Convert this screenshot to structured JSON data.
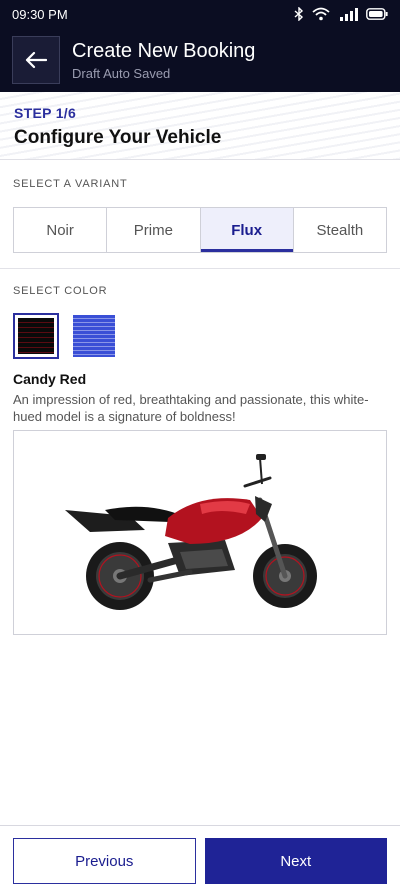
{
  "status": {
    "time": "09:30 PM",
    "icons": [
      "bluetooth-icon",
      "wifi-icon",
      "signal-5g-icon",
      "battery-icon"
    ]
  },
  "header": {
    "title": "Create New Booking",
    "subtitle": "Draft Auto Saved",
    "back_icon": "arrow-left-icon"
  },
  "step": {
    "label": "STEP 1/6",
    "title": "Configure Your Vehicle"
  },
  "variant": {
    "section_label": "SELECT A VARIANT",
    "options": [
      "Noir",
      "Prime",
      "Flux",
      "Stealth"
    ],
    "selected": "Flux"
  },
  "color": {
    "section_label": "SELECT COLOR",
    "swatches": [
      {
        "name": "red-swatch",
        "hex": "#5a0b12"
      },
      {
        "name": "blue-swatch",
        "hex": "#3a4fd6"
      }
    ],
    "selected_name": "Candy Red",
    "description": "An impression of red, breathtaking and passionate, this white-hued model is a signature of boldness!"
  },
  "footer": {
    "previous_label": "Previous",
    "next_label": "Next"
  },
  "colors": {
    "brand_dark": "#0b0d22",
    "accent": "#2b2f9e",
    "bike_red": "#b3121f"
  }
}
